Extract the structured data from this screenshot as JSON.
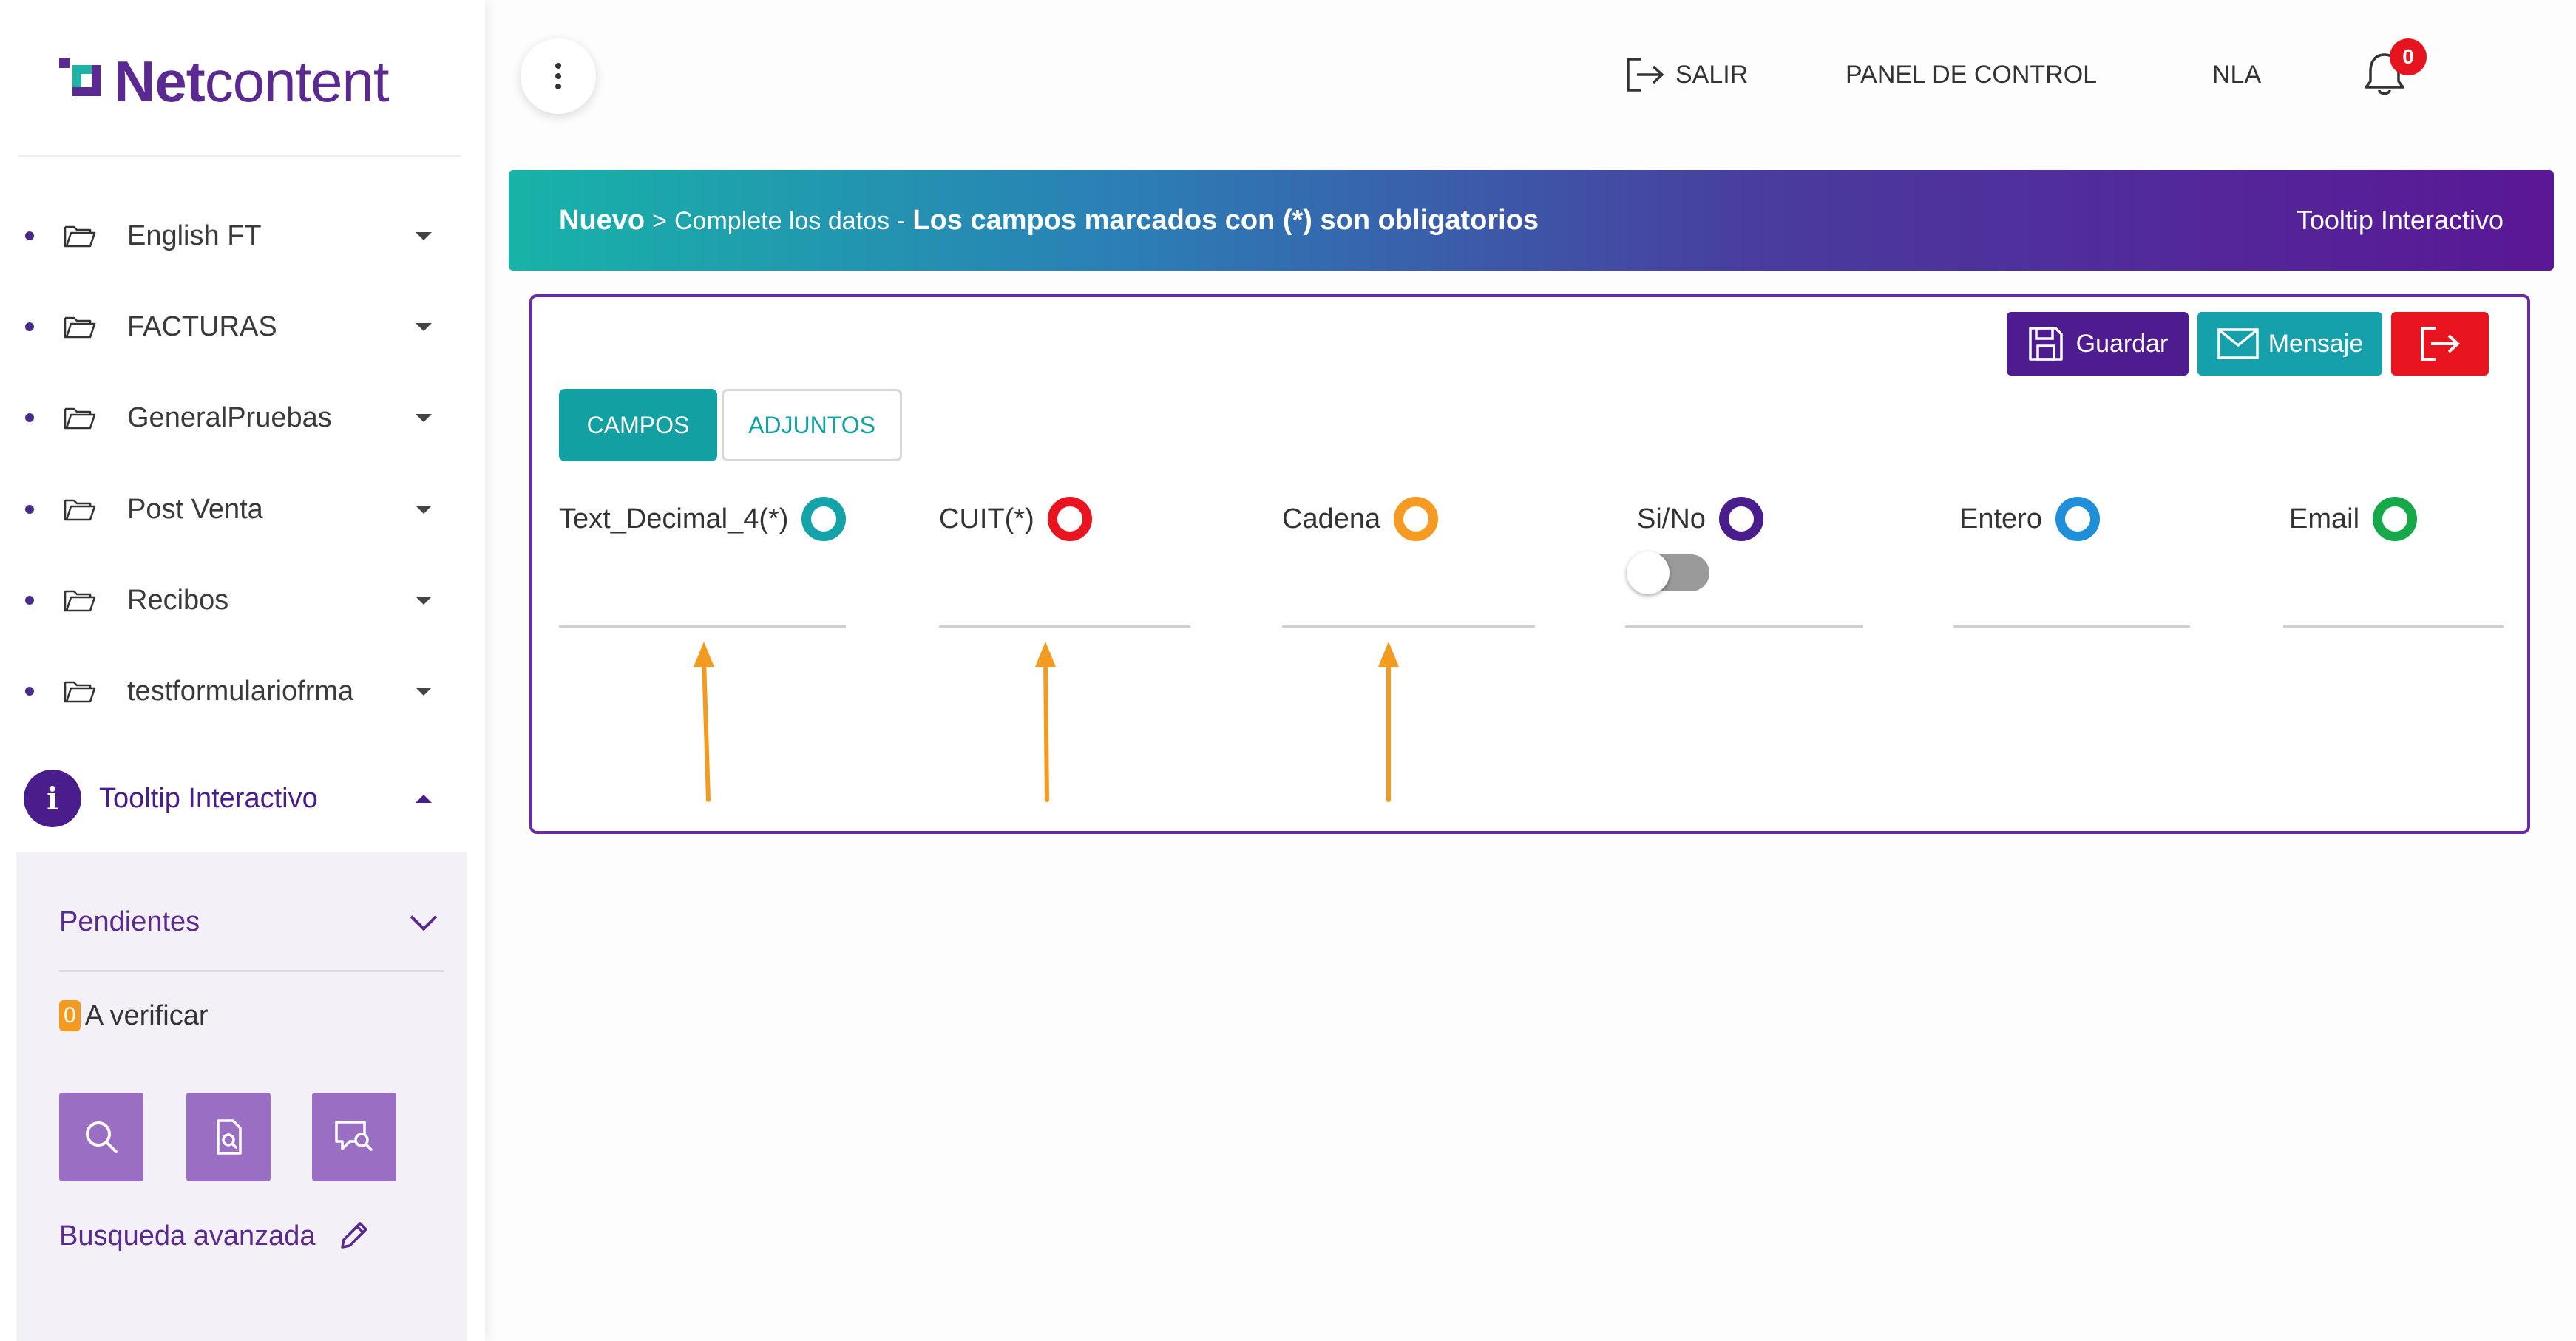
{
  "logo": {
    "part1": "Net",
    "part2": "content"
  },
  "sidebar": {
    "items": [
      {
        "label": "English FT"
      },
      {
        "label": "FACTURAS"
      },
      {
        "label": "GeneralPruebas"
      },
      {
        "label": "Post Venta"
      },
      {
        "label": "Recibos"
      },
      {
        "label": "testformulariofrma"
      }
    ],
    "active_item": {
      "icon_glyph": "i",
      "label": "Tooltip Interactivo"
    },
    "submenu": {
      "pendientes": "Pendientes",
      "count": "0",
      "verify": "A verificar",
      "busqueda": "Busqueda avanzada"
    }
  },
  "topbar": {
    "salir": "SALIR",
    "panel": "PANEL DE CONTROL",
    "user": "NLA",
    "notifications": "0"
  },
  "banner": {
    "nuevo": "Nuevo",
    "sep": ">",
    "complete": "Complete los datos",
    "dash": "-",
    "required_note": "Los campos marcados con (*) son obligatorios",
    "right": "Tooltip Interactivo"
  },
  "actions": {
    "guardar": "Guardar",
    "mensaje": "Mensaje"
  },
  "tabs": [
    {
      "label": "CAMPOS",
      "active": true
    },
    {
      "label": "ADJUNTOS",
      "active": false
    }
  ],
  "fields": [
    {
      "label": "Text_Decimal_4(*)",
      "ring_color": "#13a3a8"
    },
    {
      "label": "CUIT(*)",
      "ring_color": "#e8141f"
    },
    {
      "label": "Cadena",
      "ring_color": "#f59a23"
    },
    {
      "label": "Si/No",
      "ring_color": "#4a1d8c",
      "toggle_on": false
    },
    {
      "label": "Entero",
      "ring_color": "#1e8fd8"
    },
    {
      "label": "Email",
      "ring_color": "#17a84a"
    }
  ],
  "colors": {
    "primary": "#5b2a91",
    "teal": "#13a3a8",
    "danger": "#e5141f",
    "arrow": "#f39b21"
  }
}
